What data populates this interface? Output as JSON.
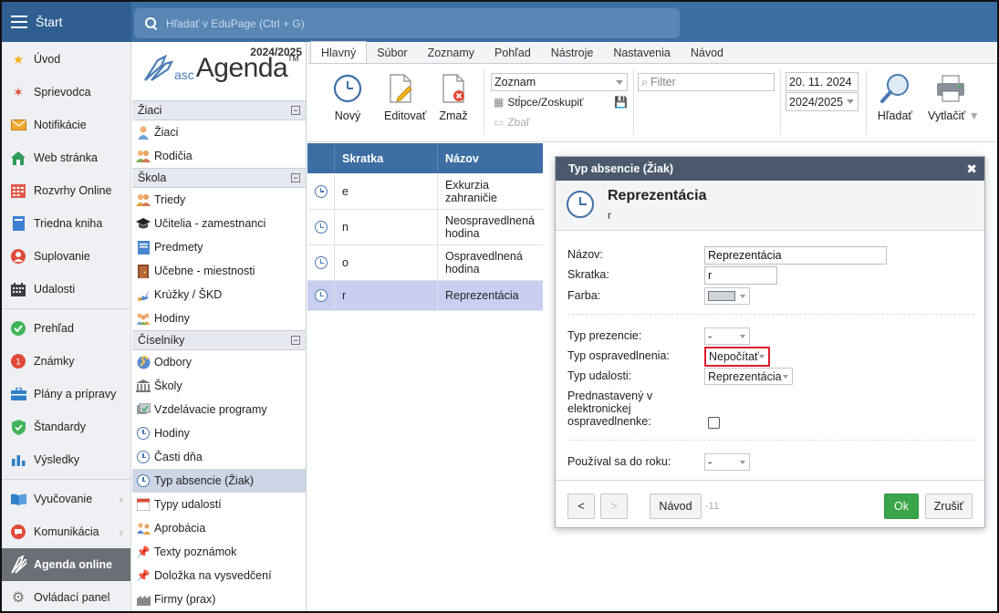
{
  "topbar": {
    "start": "Štart",
    "search_placeholder": "Hľadať v EduPage (Ctrl + G)"
  },
  "mainnav": {
    "items": [
      "Úvod",
      "Sprievodca",
      "Notifikácie",
      "Web stránka",
      "Rozvrhy Online",
      "Triedna kniha",
      "Suplovanie",
      "Udalosti",
      "Prehľad",
      "Známky",
      "Plány a prípravy",
      "Štandardy",
      "Výsledky",
      "Vyučovanie",
      "Komunikácia",
      "Agenda online",
      "Ovládací panel"
    ]
  },
  "brand": {
    "year": "2024/2025",
    "asc": "asc",
    "agenda": "Agenda",
    "tm": "TM"
  },
  "sidebar": {
    "groups": [
      "Žiaci",
      "Škola",
      "Číselníky"
    ],
    "ziaci": [
      "Žiaci",
      "Rodičia"
    ],
    "skola": [
      "Triedy",
      "Učitelia - zamestnanci",
      "Predmety",
      "Učebne - miestnosti",
      "Krúžky / ŠKD",
      "Hodiny"
    ],
    "ciselniky": [
      "Odbory",
      "Školy",
      "Vzdelávacie programy",
      "Hodiny",
      "Časti dňa",
      "Typ absencie (Žiak)",
      "Typy udalostí",
      "Aprobácia",
      "Texty poznámok",
      "Doložka na vysvedčení",
      "Firmy (prax)"
    ]
  },
  "tabs": [
    "Hlavný",
    "Súbor",
    "Zoznamy",
    "Pohľad",
    "Nástroje",
    "Nastavenia",
    "Návod"
  ],
  "toolbar": {
    "new": "Nový",
    "edit": "Editovať",
    "delete": "Zmaž",
    "view_select": "Zoznam",
    "columns": "Stĺpce/Zoskupiť",
    "collapse": "Zbaľ",
    "filter_placeholder": "Filter",
    "date": "20. 11. 2024",
    "year": "2024/2025",
    "search": "Hľadať",
    "print": "Vytlačiť"
  },
  "table": {
    "headers": [
      "Skratka",
      "Názov"
    ],
    "rows": [
      {
        "code": "e",
        "name": "Exkurzia zahraničie"
      },
      {
        "code": "n",
        "name": "Neospravedlnená hodina"
      },
      {
        "code": "o",
        "name": "Ospravedlnená hodina"
      },
      {
        "code": "r",
        "name": "Reprezentácia"
      }
    ]
  },
  "dialog": {
    "title": "Typ absencie (Žiak)",
    "heading": "Reprezentácia",
    "subheading": "r",
    "labels": {
      "name": "Názov:",
      "code": "Skratka:",
      "color": "Farba:",
      "presence": "Typ prezencie:",
      "excuse": "Typ ospravedlnenia:",
      "event": "Typ udalosti:",
      "default1": "Prednastavený v",
      "default2": "elektronickej",
      "default3": "ospravedlnenke:",
      "used_until": "Používal sa do roku:"
    },
    "values": {
      "name": "Reprezentácia",
      "code": "r",
      "color": "#cfd4da",
      "presence": "-",
      "excuse": "Nepočítať",
      "event": "Reprezentácia",
      "used_until": "-"
    },
    "footer": {
      "prev": "<",
      "next": ">",
      "help": "Návod",
      "counter": "-11",
      "ok": "Ok",
      "cancel": "Zrušiť"
    }
  },
  "colors": {
    "topbar": "#3c6ea3",
    "table_header": "#3c6ea3",
    "ok": "#3aa54a",
    "highlight": "#e01e2e",
    "selected_row": "#c9cff0"
  }
}
